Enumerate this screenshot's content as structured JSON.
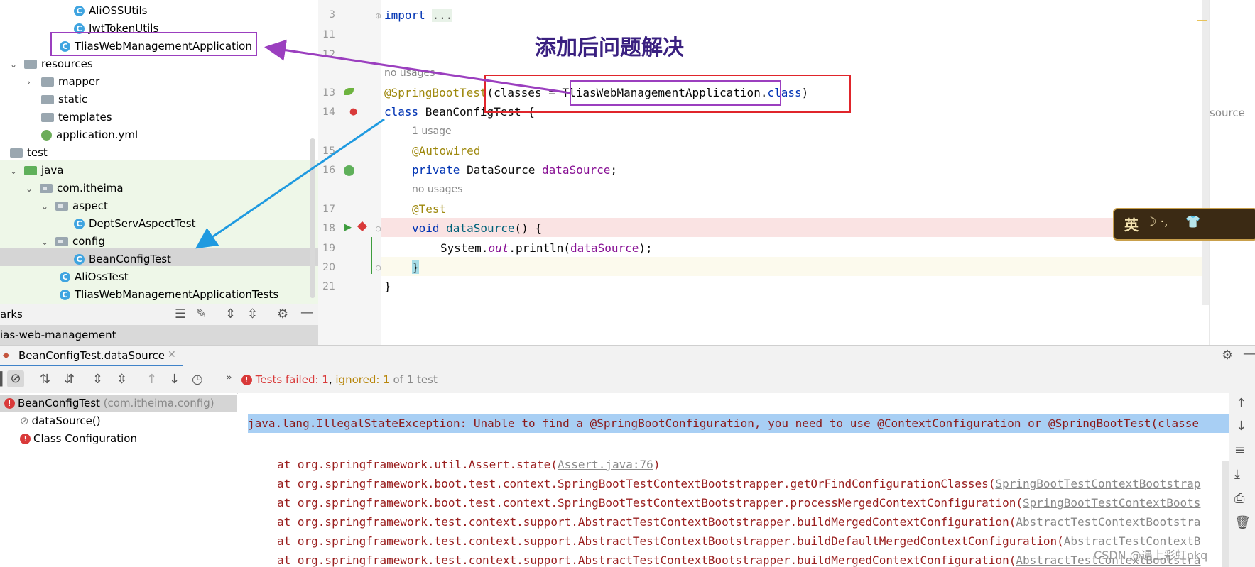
{
  "project_tree": {
    "items": [
      {
        "label": "AliOSSUtils",
        "type": "class"
      },
      {
        "label": "JwtTokenUtils",
        "type": "class"
      },
      {
        "label": "TliasWebManagementApplication",
        "type": "class"
      },
      {
        "label": "resources",
        "type": "folder"
      },
      {
        "label": "mapper",
        "type": "folder"
      },
      {
        "label": "static",
        "type": "folder"
      },
      {
        "label": "templates",
        "type": "folder"
      },
      {
        "label": "application.yml",
        "type": "yml"
      },
      {
        "label": "test",
        "type": "folder"
      },
      {
        "label": "java",
        "type": "folder"
      },
      {
        "label": "com.itheima",
        "type": "package"
      },
      {
        "label": "aspect",
        "type": "package"
      },
      {
        "label": "DeptServAspectTest",
        "type": "class"
      },
      {
        "label": "config",
        "type": "package"
      },
      {
        "label": "BeanConfigTest",
        "type": "class"
      },
      {
        "label": "AliOssTest",
        "type": "class"
      },
      {
        "label": "TliasWebManagementApplicationTests",
        "type": "class"
      }
    ],
    "bookmarks_label": "arks",
    "module_label": "ias-web-management"
  },
  "editor": {
    "line_numbers": [
      "3",
      "11",
      "12",
      "13",
      "14",
      "15",
      "16",
      "17",
      "18",
      "19",
      "20",
      "21"
    ],
    "import_kw": "import",
    "import_rest": "...",
    "hint_no_usages_1": "no usages",
    "hint_1_usage": "1 usage",
    "hint_no_usages_2": "no usages",
    "annotation_springboottest": "@SpringBootTest",
    "sbt_open": "(classes = ",
    "sbt_classname": "TliasWebManagementApplication",
    "sbt_dot": ".",
    "sbt_class_kw": "class",
    "sbt_close": ")",
    "class_kw": "class",
    "class_name": " BeanConfigTest {",
    "autowired": "@Autowired",
    "private_kw": "private",
    "field_type": " DataSource ",
    "field_name": "dataSource",
    "semicolon": ";",
    "test_ann": "@Test",
    "void_kw": "void",
    "method_name": "dataSource",
    "method_tail": "() {",
    "print_pre": "System.",
    "print_out": "out",
    "print_mid": ".println(",
    "print_arg": "dataSource",
    "print_end": ");",
    "brace_close": "}",
    "class_close": "}",
    "side_text": "source",
    "overlay_title": "添加后问题解决"
  },
  "run_panel": {
    "tab_label": "BeanConfigTest.dataSource",
    "status_failed": "Tests failed: ",
    "failed_count": "1",
    "sep": ", ",
    "ignored_label": "ignored: ",
    "ignored_count": "1",
    "of_text": " of 1 test",
    "tests": [
      {
        "label": "BeanConfigTest",
        "sub": "(com.itheima.config)"
      },
      {
        "label": "dataSource()"
      },
      {
        "label": "Class Configuration"
      }
    ],
    "exception_pre": "java.lang.IllegalStateException: Unable to find a ",
    "exception_highlight": "@SpringBootConfiguration,",
    "exception_post": " you need to use @ContextConfiguration or @SpringBootTest(classe",
    "trace": [
      {
        "text": "at org.springframework.util.Assert.state(",
        "link": "Assert.java:76",
        "end": ")"
      },
      {
        "text": "at org.springframework.boot.test.context.SpringBootTestContextBootstrapper.getOrFindConfigurationClasses(",
        "link": "SpringBootTestContextBootstrap",
        "end": ""
      },
      {
        "text": "at org.springframework.boot.test.context.SpringBootTestContextBootstrapper.processMergedContextConfiguration(",
        "link": "SpringBootTestContextBoots",
        "end": ""
      },
      {
        "text": "at org.springframework.test.context.support.AbstractTestContextBootstrapper.buildMergedContextConfiguration(",
        "link": "AbstractTestContextBootstra",
        "end": ""
      },
      {
        "text": "at org.springframework.test.context.support.AbstractTestContextBootstrapper.buildDefaultMergedContextConfiguration(",
        "link": "AbstractTestContextB",
        "end": ""
      },
      {
        "text": "at org.springframework.test.context.support.AbstractTestContextBootstrapper.buildMergedContextConfiguration(",
        "link": "AbstractTestContextBootstra",
        "end": ""
      }
    ],
    "watermark": "CSDN @遇上彩虹pkq",
    "widget_char": "英"
  },
  "colors": {
    "annotation_box": "#e0252b",
    "purple_box": "#9b3fbf",
    "blue_arrow": "#1f9ae0",
    "exception_bg": "#a8cff4",
    "error_red": "#d93a3a"
  }
}
